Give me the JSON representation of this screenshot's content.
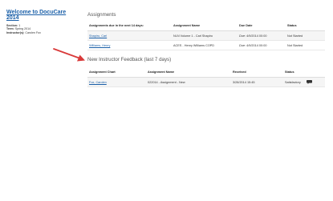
{
  "sidebar": {
    "welcome_link": "Welcome to DocuCare 2014",
    "section_label": "Section:",
    "section_value": "1",
    "term_label": "Term:",
    "term_value": "Spring 2014",
    "instructor_label": "Instructor(s):",
    "instructor_value": "Carolen Fox"
  },
  "assignments": {
    "heading": "Assignments",
    "headers": {
      "due": "Assignments due in the next 14 days:",
      "name": "Assignment Name",
      "date": "Due Date",
      "status": "Status"
    },
    "rows": [
      {
        "patient": "Shapiro, Carl",
        "assignment": "NLN Volume 1 - Carl Shapiro",
        "due_label": "Due:",
        "due_value": "4/9/2014 00:00",
        "status": "Not Started"
      },
      {
        "patient": "Williams, Henry",
        "assignment": "ACES - Henry Williams COPD",
        "due_label": "Due:",
        "due_value": "4/9/2014 00:00",
        "status": "Not Started"
      }
    ]
  },
  "feedback": {
    "heading": "New Instructor Feedback (last 7 days)",
    "headers": {
      "chart": "Assignment Chart",
      "name": "Assignment Name",
      "received": "Received",
      "status": "Status"
    },
    "rows": [
      {
        "patient": "Fox, Carolen",
        "assignment": "022014 - Assignment - New",
        "received": "3/28/2014 15:45",
        "status": "Satisfactory",
        "icon": "comment-icon"
      }
    ]
  },
  "colors": {
    "link": "#1a5fa8",
    "annotation_arrow": "#d93a3a"
  }
}
